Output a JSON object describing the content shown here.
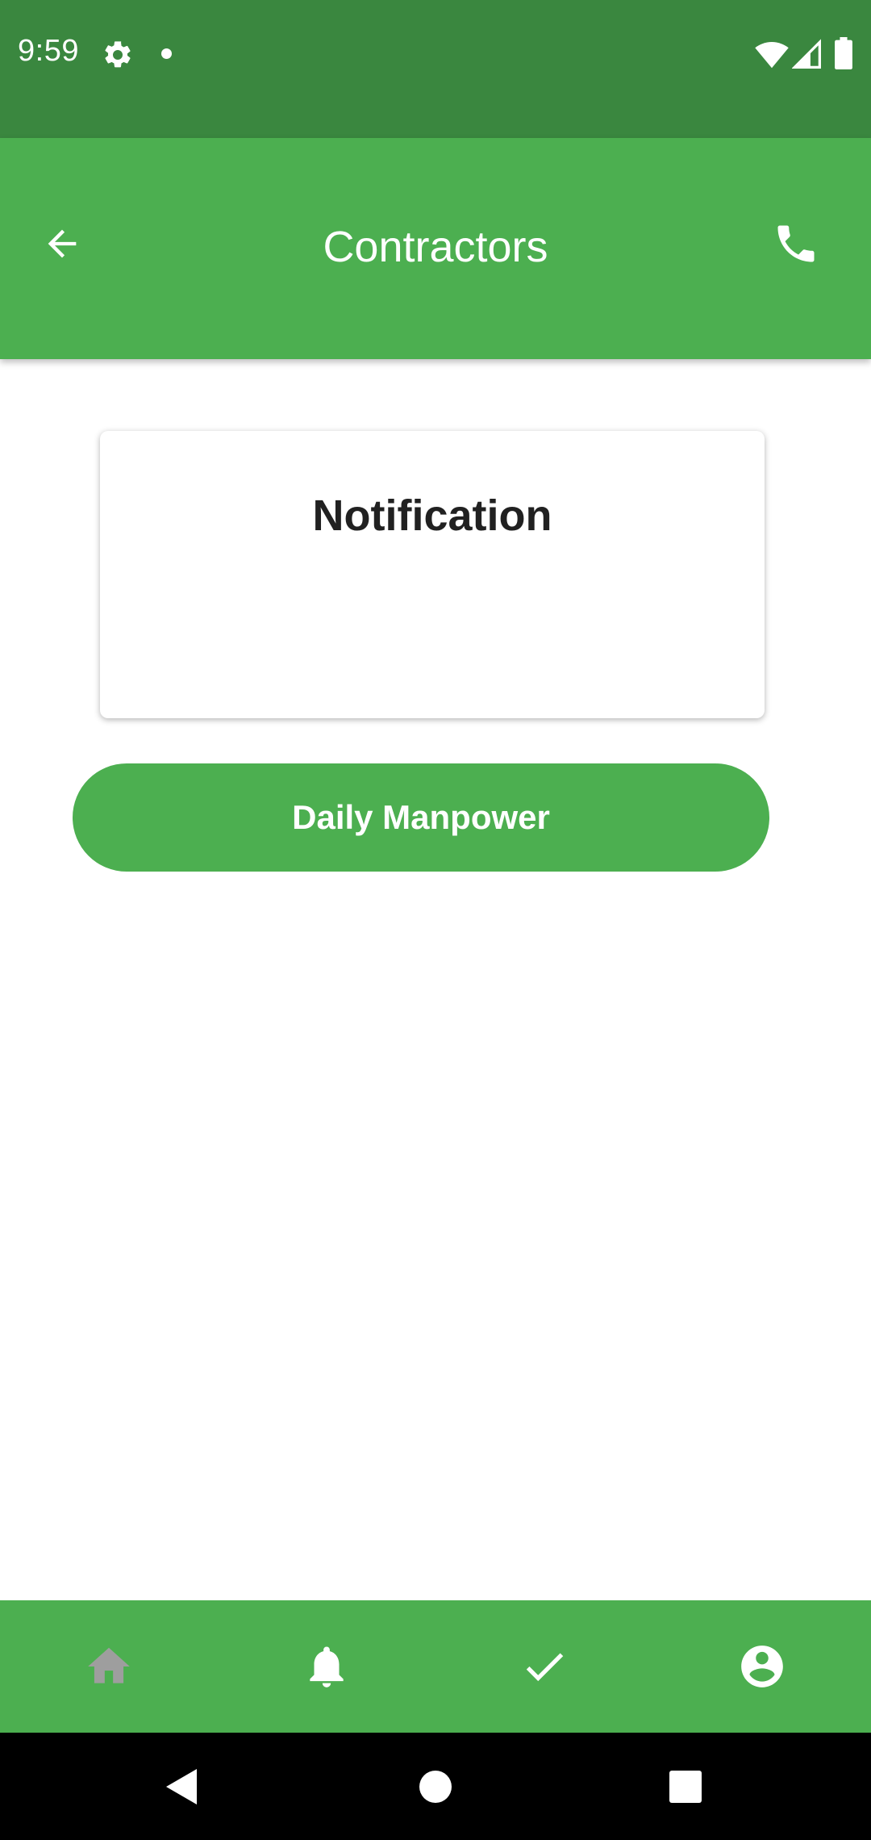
{
  "status_bar": {
    "time": "9:59",
    "icons": [
      "settings-icon",
      "notification-dot-icon",
      "wifi-icon",
      "cellular-signal-icon",
      "battery-icon"
    ],
    "background": "#3a873f"
  },
  "app_bar": {
    "title": "Contractors",
    "background": "#4caf50",
    "left_icon": "arrow-back-icon",
    "right_icon": "phone-icon"
  },
  "notification_card": {
    "title": "Notification"
  },
  "manpower_button": {
    "label": "Daily Manpower",
    "color": "#4caf50"
  },
  "bottom_nav": {
    "background": "#4caf50",
    "items": [
      {
        "icon": "home-icon",
        "active": false,
        "color": "#9e9e9e"
      },
      {
        "icon": "bell-icon",
        "active": true,
        "color": "#ffffff"
      },
      {
        "icon": "check-icon",
        "active": true,
        "color": "#ffffff"
      },
      {
        "icon": "account-circle-icon",
        "active": true,
        "color": "#ffffff"
      }
    ]
  },
  "system_nav": {
    "buttons": [
      "back-triangle-icon",
      "home-circle-icon",
      "recents-square-icon"
    ]
  }
}
